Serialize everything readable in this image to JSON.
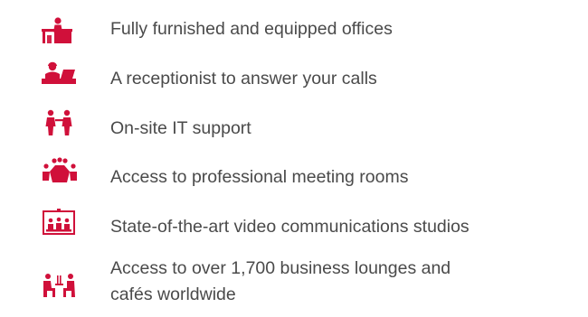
{
  "accent_color": "#d0103a",
  "text_color": "#4a4a4a",
  "features": [
    {
      "icon": "office-desk-icon",
      "label": "Fully furnished and equipped offices"
    },
    {
      "icon": "receptionist-icon",
      "label": "A receptionist to answer your calls"
    },
    {
      "icon": "it-support-icon",
      "label": "On-site IT support"
    },
    {
      "icon": "meeting-room-icon",
      "label": "Access to professional meeting rooms"
    },
    {
      "icon": "video-conference-icon",
      "label": "State-of-the-art video communications studios"
    },
    {
      "icon": "business-lounge-icon",
      "label": "Access to over 1,700 business lounges and cafés worldwide"
    }
  ]
}
